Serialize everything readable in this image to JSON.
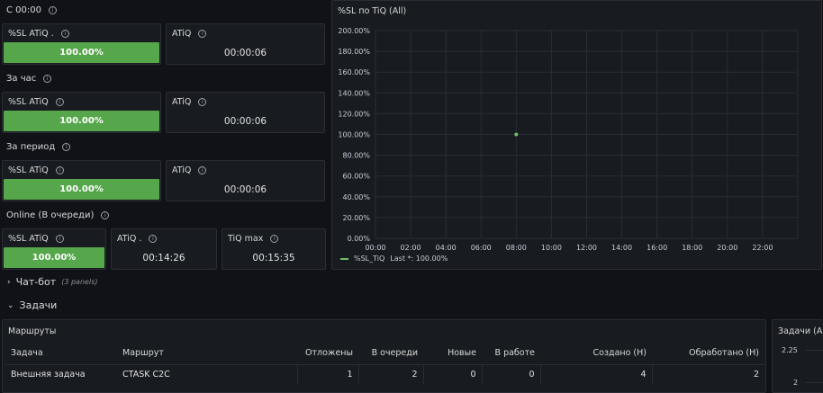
{
  "rows": {
    "r1": "С 00:00",
    "r2": "За час",
    "r3": "За период",
    "r4": "Online (В очереди)"
  },
  "panels": {
    "p1a": {
      "title": "%SL ATiQ .",
      "value": "100.00%"
    },
    "p1b": {
      "title": "ATiQ",
      "value": "00:00:06"
    },
    "p2a": {
      "title": "%SL ATiQ",
      "value": "100.00%"
    },
    "p2b": {
      "title": "ATiQ",
      "value": "00:00:06"
    },
    "p3a": {
      "title": "%SL ATiQ",
      "value": "100.00%"
    },
    "p3b": {
      "title": "ATiQ",
      "value": "00:00:06"
    },
    "p4a": {
      "title": "%SL ATiQ",
      "value": "100.00%"
    },
    "p4b": {
      "title": "ATiQ .",
      "value": "00:14:26"
    },
    "p4c": {
      "title": "TiQ max",
      "value": "00:15:35"
    }
  },
  "chart_panel": {
    "title": "%SL по TiQ (All)",
    "legend_name": "%SL_TiQ",
    "legend_stat": "Last *: 100.00%"
  },
  "chart_data": {
    "type": "scatter",
    "title": "%SL по TiQ (All)",
    "x_ticks": [
      "00:00",
      "02:00",
      "04:00",
      "06:00",
      "08:00",
      "10:00",
      "12:00",
      "14:00",
      "16:00",
      "18:00",
      "20:00",
      "22:00"
    ],
    "y_ticks": [
      "0.00%",
      "20.00%",
      "40.00%",
      "60.00%",
      "80.00%",
      "100.00%",
      "120.00%",
      "140.00%",
      "160.00%",
      "180.00%",
      "200.00%"
    ],
    "ylim": [
      0,
      200
    ],
    "xlim_hours": [
      0,
      24
    ],
    "series": [
      {
        "name": "%SL_TiQ",
        "points": [
          {
            "x": "08:00",
            "y": 100
          }
        ]
      }
    ],
    "grid": true,
    "legend_position": "bottom-left",
    "color": "#73bf69"
  },
  "sections": {
    "chatbot": {
      "label": "Чат-бот",
      "note": "(3 panels)"
    },
    "tasks": {
      "label": "Задачи"
    }
  },
  "routes_table": {
    "title": "Маршруты",
    "headers": [
      "Задача",
      "Маршрут",
      "Отложены",
      "В очереди",
      "Новые",
      "В работе",
      "Создано (Н)",
      "Обработано (Н)"
    ],
    "rows": [
      [
        "Внешняя задача",
        "CTASK C2C",
        "1",
        "2",
        "0",
        "0",
        "4",
        "2"
      ]
    ]
  },
  "tasks_panel": {
    "title": "Задачи (All",
    "y_ticks": [
      "2.25",
      "2"
    ]
  },
  "colors": {
    "gauge_green": "#56a64b",
    "series_green": "#73bf69",
    "background": "#111217",
    "panel": "#181b1f"
  }
}
